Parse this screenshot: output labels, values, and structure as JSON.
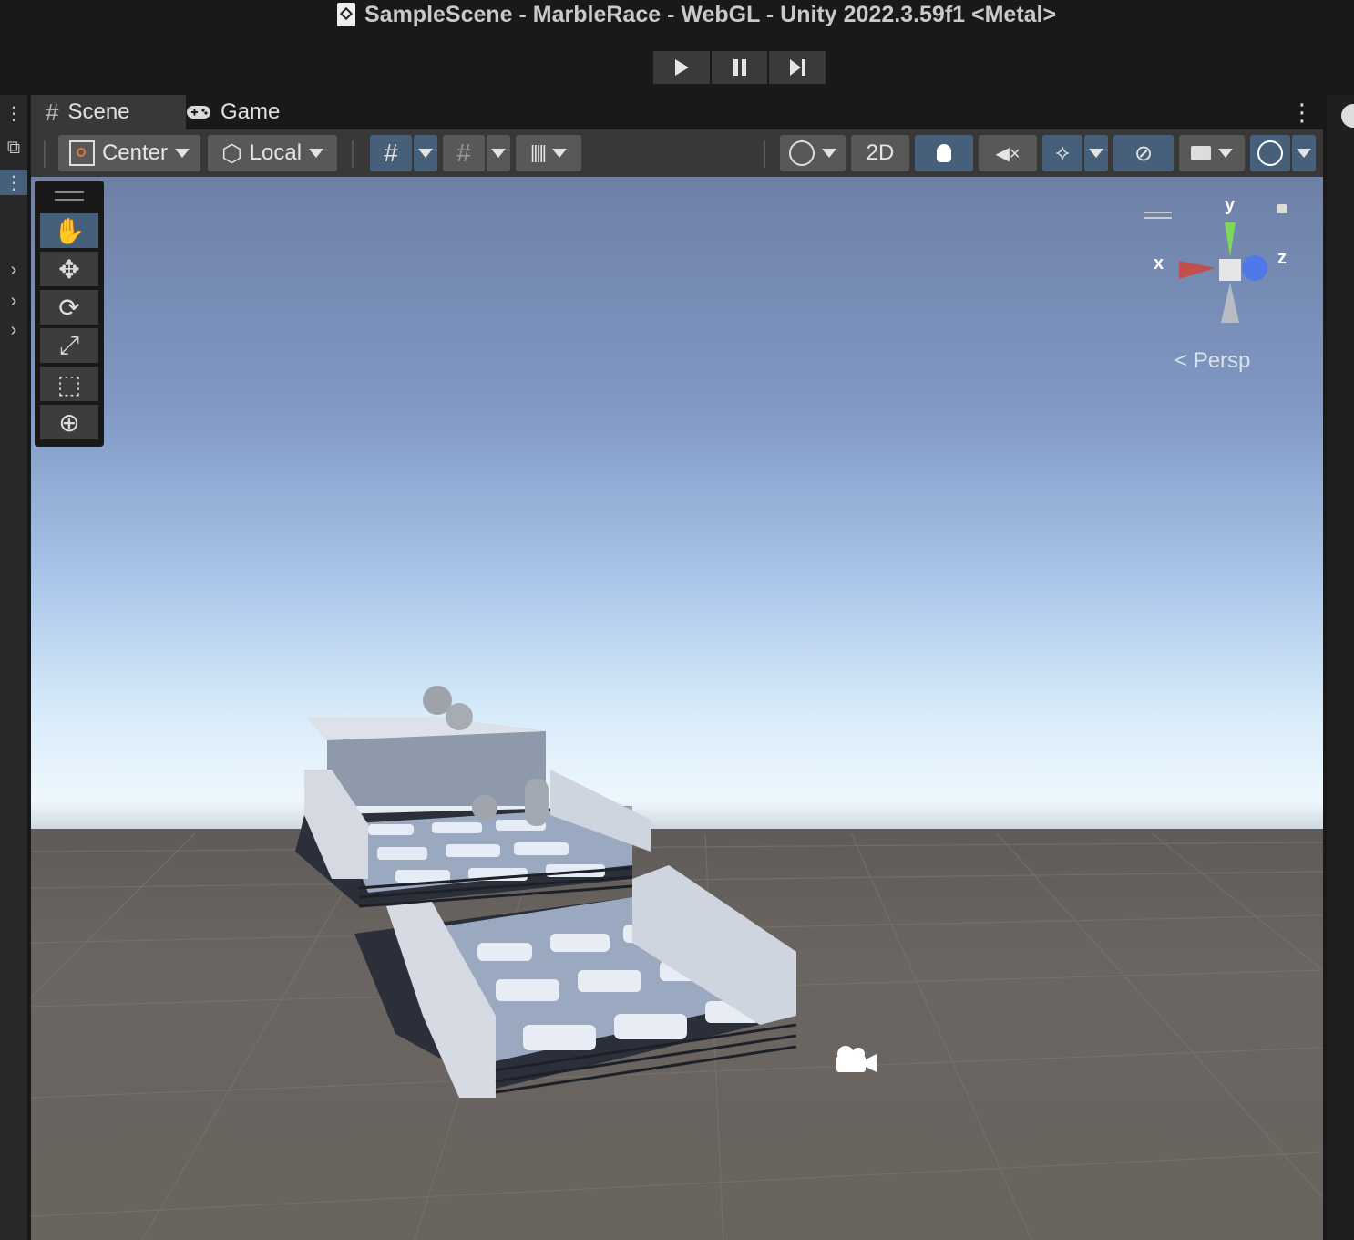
{
  "window": {
    "title": "SampleScene - MarbleRace - WebGL - Unity 2022.3.59f1 <Metal>"
  },
  "playback": {
    "play": "play-icon",
    "pause": "pause-icon",
    "step": "step-icon"
  },
  "tabs": [
    {
      "label": "Scene",
      "icon": "grid-hash-icon"
    },
    {
      "label": "Game",
      "icon": "gamepad-icon"
    }
  ],
  "toolbar": {
    "pivot_mode": "Center",
    "pivot_rotation": "Local",
    "view_2d": "2D"
  },
  "tools": [
    "hand-icon",
    "move-icon",
    "rotate-icon",
    "scale-icon",
    "rect-icon",
    "transform-icon"
  ],
  "gizmo": {
    "x": "x",
    "y": "y",
    "z": "z",
    "projection": "Persp"
  },
  "colors": {
    "active_blue": "#46607c",
    "x_axis": "#c0504d",
    "y_axis": "#7fd65a",
    "z_axis": "#4f78e8"
  }
}
